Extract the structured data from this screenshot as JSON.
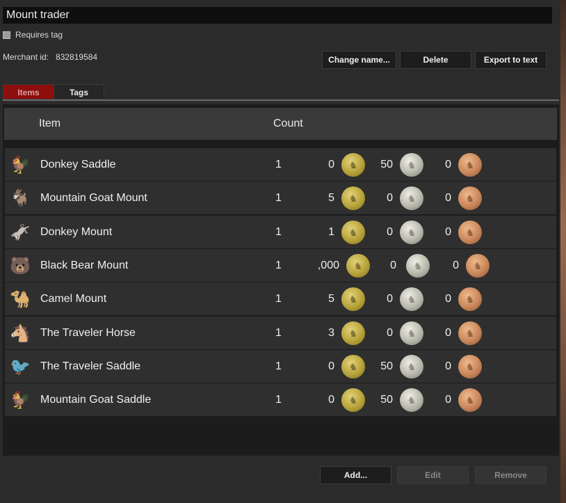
{
  "window": {
    "title": "Mount trader"
  },
  "options": {
    "requires_tag_label": "Requires tag"
  },
  "merchant": {
    "label": "Merchant id:",
    "id": "832819584"
  },
  "toolbar": {
    "change_name_label": "Change name...",
    "delete_label": "Delete",
    "export_label": "Export to text"
  },
  "tabs": [
    {
      "label": "Items",
      "active": true
    },
    {
      "label": "Tags",
      "active": false
    }
  ],
  "table": {
    "headers": {
      "item": "Item",
      "count": "Count"
    },
    "rows": [
      {
        "icon": "saddle-icon",
        "glyph": "🐓",
        "name": "Donkey Saddle",
        "count": "1",
        "gold": "0",
        "silver": "50",
        "copper": "0"
      },
      {
        "icon": "goat-icon",
        "glyph": "🐐",
        "name": "Mountain Goat Mount",
        "count": "1",
        "gold": "5",
        "silver": "0",
        "copper": "0"
      },
      {
        "icon": "donkey-icon",
        "glyph": "🫏",
        "name": "Donkey Mount",
        "count": "1",
        "gold": "1",
        "silver": "0",
        "copper": "0"
      },
      {
        "icon": "bear-icon",
        "glyph": "🐻",
        "name": "Black Bear Mount",
        "count": "1",
        "gold": ",000",
        "silver": "0",
        "copper": "0"
      },
      {
        "icon": "camel-icon",
        "glyph": "🐪",
        "name": "Camel Mount",
        "count": "1",
        "gold": "5",
        "silver": "0",
        "copper": "0"
      },
      {
        "icon": "horse-icon",
        "glyph": "🐴",
        "name": "The Traveler Horse",
        "count": "1",
        "gold": "3",
        "silver": "0",
        "copper": "0"
      },
      {
        "icon": "saddle-icon",
        "glyph": "🐦",
        "name": "The Traveler Saddle",
        "count": "1",
        "gold": "0",
        "silver": "50",
        "copper": "0"
      },
      {
        "icon": "saddle-icon",
        "glyph": "🐓",
        "name": "Mountain Goat Saddle",
        "count": "1",
        "gold": "0",
        "silver": "50",
        "copper": "0"
      }
    ]
  },
  "footer": {
    "add_label": "Add...",
    "edit_label": "Edit",
    "remove_label": "Remove"
  },
  "colors": {
    "active_tab": "#8e0d0d",
    "panel": "#1c1c1c",
    "row": "#2f2f2f"
  }
}
